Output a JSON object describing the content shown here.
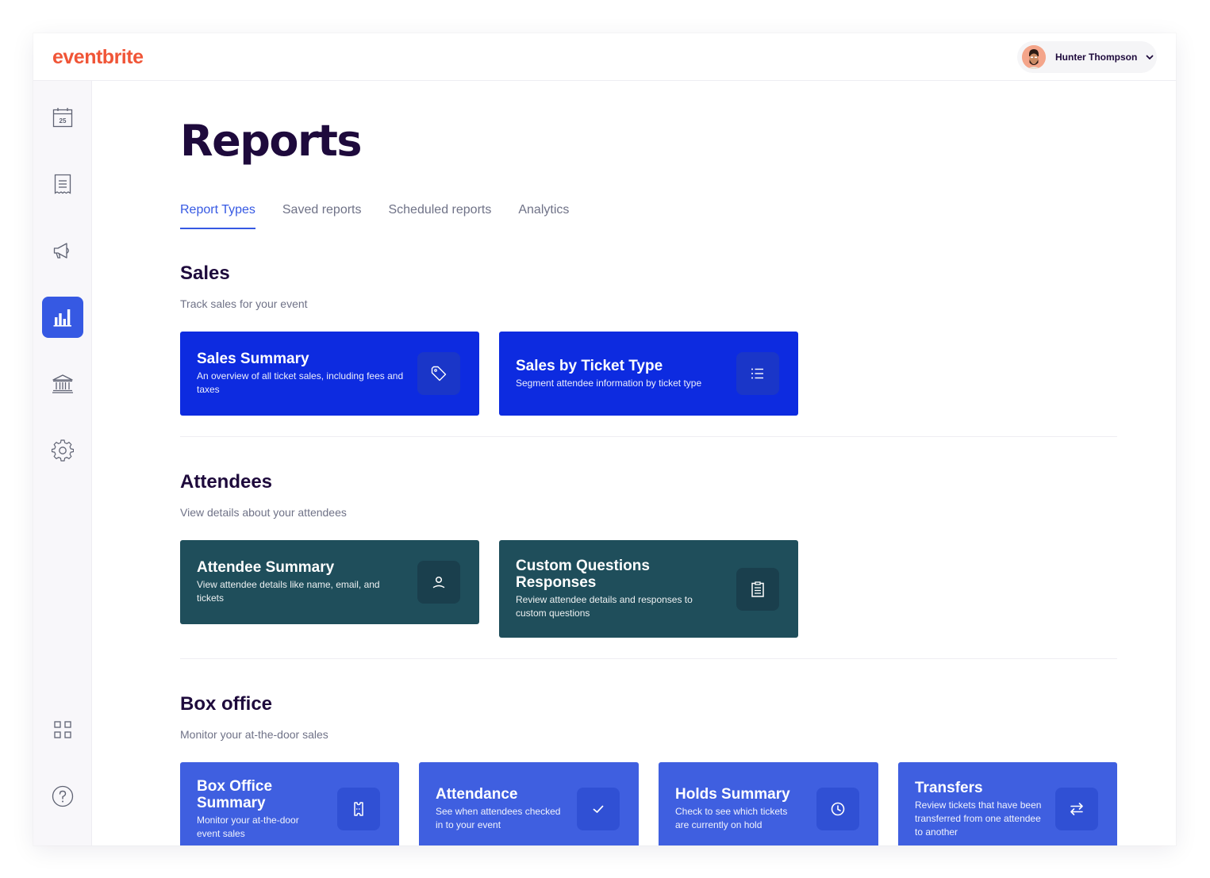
{
  "app": {
    "logo": "eventbrite",
    "user_name": "Hunter Thompson"
  },
  "sidebar": {
    "items": [
      {
        "icon": "calendar-icon",
        "badge": "25"
      },
      {
        "icon": "orders-list-icon"
      },
      {
        "icon": "megaphone-icon"
      },
      {
        "icon": "bar-chart-icon",
        "active": true
      },
      {
        "icon": "bank-icon"
      },
      {
        "icon": "gear-icon"
      },
      {
        "icon": "apps-grid-icon"
      },
      {
        "icon": "help-icon"
      }
    ]
  },
  "page": {
    "title": "Reports"
  },
  "tabs": [
    {
      "label": "Report Types",
      "active": true
    },
    {
      "label": "Saved reports"
    },
    {
      "label": "Scheduled reports"
    },
    {
      "label": "Analytics"
    }
  ],
  "sections": {
    "sales": {
      "title": "Sales",
      "subtitle": "Track sales for your event",
      "cards": [
        {
          "title": "Sales Summary",
          "description": "An overview of all ticket sales, including fees and taxes",
          "icon": "tag-icon"
        },
        {
          "title": "Sales by Ticket Type",
          "description": "Segment attendee information by ticket type",
          "icon": "list-icon"
        }
      ]
    },
    "attendees": {
      "title": "Attendees",
      "subtitle": "View details about your attendees",
      "cards": [
        {
          "title": "Attendee Summary",
          "description": "View attendee details like name, email, and tickets",
          "icon": "user-icon"
        },
        {
          "title": "Custom Questions Responses",
          "description": "Review attendee details and responses to custom questions",
          "icon": "clipboard-icon"
        }
      ]
    },
    "box_office": {
      "title": "Box office",
      "subtitle": "Monitor your at-the-door sales",
      "cards": [
        {
          "title": "Box Office Summary",
          "description": "Monitor your at-the-door event sales",
          "icon": "ticket-icon"
        },
        {
          "title": "Attendance",
          "description": "See when attendees checked in to your event",
          "icon": "check-icon"
        },
        {
          "title": "Holds Summary",
          "description": "Check to see which tickets are currently on hold",
          "icon": "clock-icon"
        },
        {
          "title": "Transfers",
          "description": "Review tickets that have been transferred from one attendee to another",
          "icon": "transfer-arrows-icon"
        }
      ]
    }
  },
  "colors": {
    "brand": "#f05537",
    "accent": "#3659e3",
    "sales_card": "#0d2be0",
    "attendee_card": "#1f4e5b",
    "box_office_card": "#3f5fe0",
    "heading": "#1e0a3c",
    "muted": "#6f7287"
  }
}
